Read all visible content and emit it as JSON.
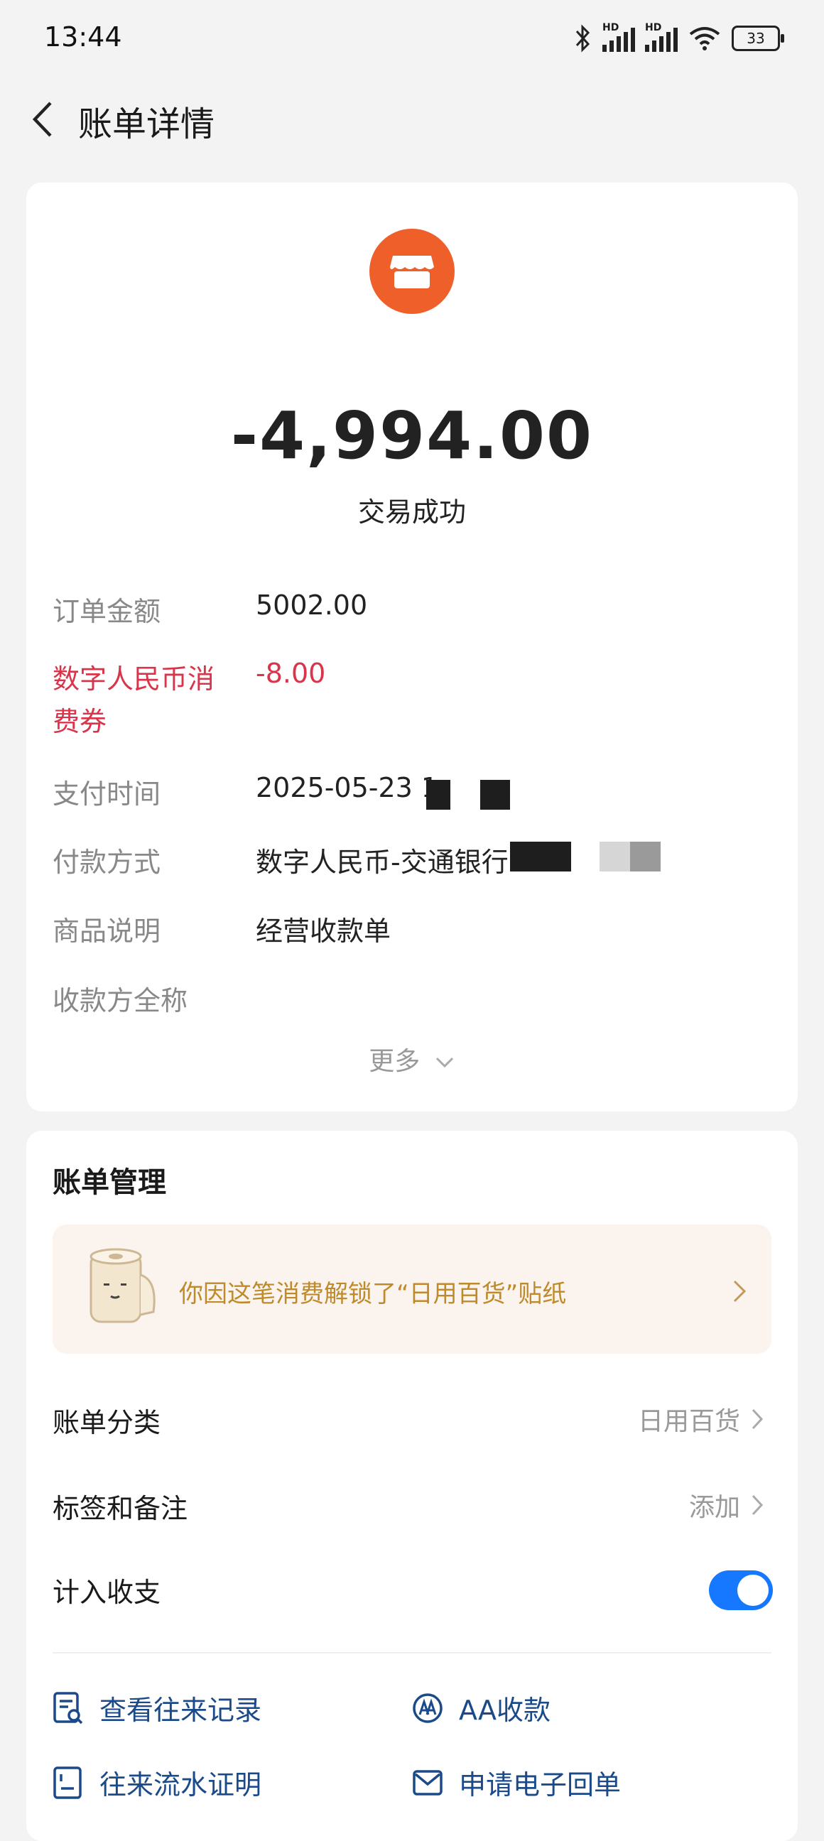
{
  "status_bar": {
    "time": "13:44",
    "battery": "33",
    "hd1": "HD",
    "hd2": "HD"
  },
  "header": {
    "title": "账单详情"
  },
  "transaction": {
    "amount": "-4,994.00",
    "status": "交易成功",
    "fields": [
      {
        "label": "订单金额",
        "value": "5002.00"
      },
      {
        "label": "数字人民币消费券",
        "value": "-8.00"
      },
      {
        "label": "支付时间",
        "value": "2025-05-23 1"
      },
      {
        "label": "付款方式",
        "value": "数字人民币-交通银行"
      },
      {
        "label": "商品说明",
        "value": "经营收款单"
      },
      {
        "label": "收款方全称",
        "value": ""
      }
    ],
    "more": "更多"
  },
  "bill_management": {
    "title": "账单管理",
    "sticker_banner": "你因这笔消费解锁了“日用百货”贴纸",
    "category": {
      "label": "账单分类",
      "value": "日用百货"
    },
    "tags": {
      "label": "标签和备注",
      "value": "添加"
    },
    "count_in": {
      "label": "计入收支",
      "enabled": true
    },
    "actions": [
      {
        "label": "查看往来记录",
        "icon": "record-search-icon"
      },
      {
        "label": "AA收款",
        "icon": "aa-icon"
      },
      {
        "label": "往来流水证明",
        "icon": "document-icon"
      },
      {
        "label": "申请电子回单",
        "icon": "mail-icon"
      }
    ]
  },
  "colors": {
    "accent": "#1677ff",
    "shop_icon": "#ef5f2a",
    "coupon_red": "#d9354a",
    "banner_text": "#bf8a2a"
  }
}
